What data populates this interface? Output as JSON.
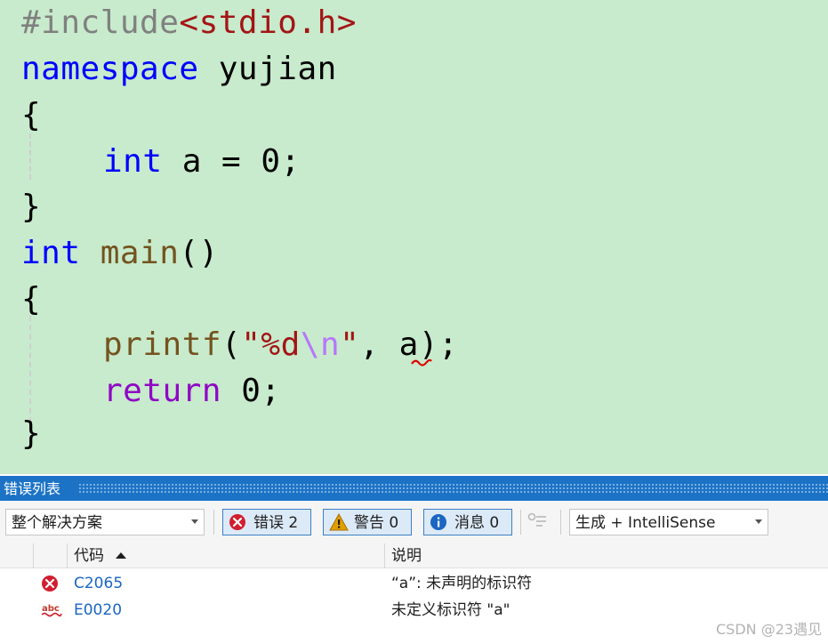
{
  "editor": {
    "include_directive": "#include",
    "include_file": "<stdio.h>",
    "namespace_keyword": "namespace",
    "namespace_name": " yujian",
    "brace_open": "{",
    "brace_close": "}",
    "int_keyword": "int",
    "var_decl_rest": " a = 0;",
    "main_name": " main",
    "main_parens": "()",
    "printf_name": "printf",
    "printf_open": "(",
    "fmt_start": "\"%d",
    "fmt_escape": "\\n",
    "fmt_end": "\"",
    "printf_comma": ", ",
    "printf_arg": "a",
    "printf_close": ");",
    "return_keyword": "return",
    "return_rest": " 0;"
  },
  "error_list": {
    "title": "错误列表",
    "scope_value": "整个解决方案",
    "errors_label": "错误 2",
    "warnings_label": "警告 0",
    "messages_label": "消息 0",
    "build_source_value": "生成 + IntelliSense",
    "columns": {
      "code": "代码",
      "description": "说明"
    },
    "rows": [
      {
        "icon": "error-circle-icon",
        "code": "C2065",
        "description": "“a”: 未声明的标识符"
      },
      {
        "icon": "abc-squiggle-icon",
        "code": "E0020",
        "description": "未定义标识符 \"a\""
      }
    ]
  },
  "watermark": "CSDN @23遇见",
  "colors": {
    "editor_background": "#c7ebcc",
    "keyword": "#0000ff",
    "control_keyword": "#8f08c4",
    "function": "#74531f",
    "string": "#a31515",
    "preprocessor": "#808080",
    "escape": "#b776fb",
    "panel_title": "#1c73c5",
    "error_code_link": "#1a66c2"
  }
}
